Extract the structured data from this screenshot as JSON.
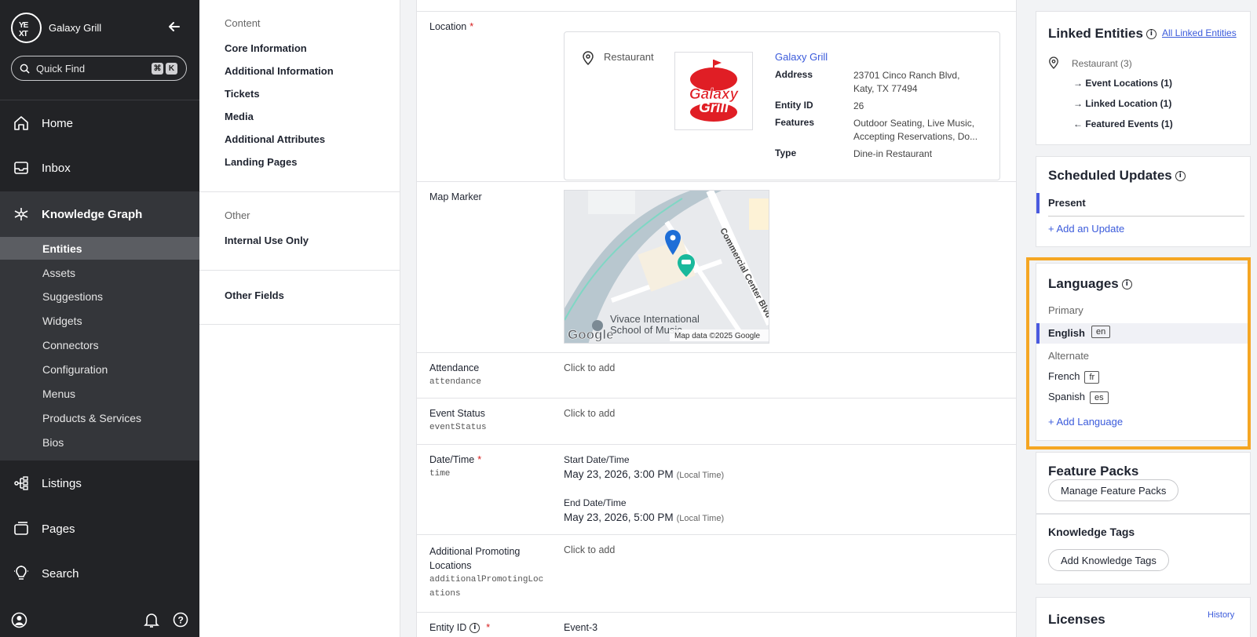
{
  "app": {
    "account_name": "Galaxy Grill",
    "logo_text": "YEXT"
  },
  "search": {
    "label": "Quick Find",
    "kbd1": "⌘",
    "kbd2": "K"
  },
  "sidebar": {
    "nav": [
      {
        "label": "Home",
        "icon": "home-icon"
      },
      {
        "label": "Inbox",
        "icon": "inbox-icon"
      },
      {
        "label": "Knowledge Graph",
        "icon": "knowledge-graph-icon"
      },
      {
        "label": "Listings",
        "icon": "listings-icon"
      },
      {
        "label": "Pages",
        "icon": "pages-icon"
      },
      {
        "label": "Search",
        "icon": "search-lightbulb-icon"
      }
    ],
    "sub_items": [
      "Entities",
      "Assets",
      "Suggestions",
      "Widgets",
      "Connectors",
      "Configuration",
      "Menus",
      "Products & Services",
      "Bios"
    ]
  },
  "content_nav": {
    "content_heading": "Content",
    "content_items": [
      "Core Information",
      "Additional Information",
      "Tickets",
      "Media",
      "Additional Attributes",
      "Landing Pages"
    ],
    "other_heading": "Other",
    "other_items": [
      "Internal Use Only"
    ],
    "other_fields": "Other Fields"
  },
  "main": {
    "location": {
      "label": "Location",
      "type_label": "Restaurant",
      "logo_line1": "Galaxy",
      "logo_line2": "Grill",
      "entity_name": "Galaxy Grill",
      "address_key": "Address",
      "address_line1": "23701 Cinco Ranch Blvd,",
      "address_line2": "Katy, TX 77494",
      "entity_id_key": "Entity ID",
      "entity_id": "26",
      "features_key": "Features",
      "features_line1": "Outdoor Seating, Live Music,",
      "features_line2": "Accepting Reservations, Do...",
      "type_key": "Type",
      "type_value": "Dine-in Restaurant"
    },
    "map_marker": {
      "label": "Map Marker",
      "street_label": "Commercial Center Blvd",
      "poi_line1": "Vivace International",
      "poi_line2": "School of Music",
      "google": "Google",
      "map_data": "Map data ©2025 Google"
    },
    "attendance": {
      "label": "Attendance",
      "api": "attendance",
      "value": "Click to add"
    },
    "event_status": {
      "label": "Event Status",
      "api": "eventStatus",
      "value": "Click to add"
    },
    "datetime": {
      "label": "Date/Time",
      "api": "time",
      "start_label": "Start Date/Time",
      "start_value": "May 23, 2026, 3:00 PM",
      "end_label": "End Date/Time",
      "end_value": "May 23, 2026, 5:00 PM",
      "local": "(Local Time)"
    },
    "promoting": {
      "label_line1": "Additional Promoting",
      "label_line2": "Locations",
      "api_line1": "additionalPromotingLoc",
      "api_line2": "ations",
      "value": "Click to add"
    },
    "entity_id": {
      "label": "Entity ID",
      "value": "Event-3"
    }
  },
  "right": {
    "linked": {
      "title": "Linked Entities",
      "all_link": "All Linked Entities",
      "group": "Restaurant (3)",
      "items": [
        {
          "arrow": "→",
          "label": "Event Locations (1)"
        },
        {
          "arrow": "→",
          "label": "Linked Location (1)"
        },
        {
          "arrow": "←",
          "label": "Featured Events (1)"
        }
      ]
    },
    "scheduled": {
      "title": "Scheduled Updates",
      "present": "Present",
      "add": "+ Add an Update"
    },
    "languages": {
      "title": "Languages",
      "primary_heading": "Primary",
      "primary": {
        "name": "English",
        "code": "en"
      },
      "alternate_heading": "Alternate",
      "alternates": [
        {
          "name": "French",
          "code": "fr"
        },
        {
          "name": "Spanish",
          "code": "es"
        }
      ],
      "add": "+ Add Language"
    },
    "feature_packs": {
      "title": "Feature Packs",
      "button": "Manage Feature Packs"
    },
    "knowledge_tags": {
      "title": "Knowledge Tags",
      "button": "Add Knowledge Tags"
    },
    "licenses": {
      "title": "Licenses",
      "history": "History"
    }
  },
  "colors": {
    "sidebar_bg": "#222326",
    "accent": "#4a5adf",
    "highlight": "#f5a623",
    "required": "#d61c1c",
    "brand_red": "#e01e25"
  }
}
